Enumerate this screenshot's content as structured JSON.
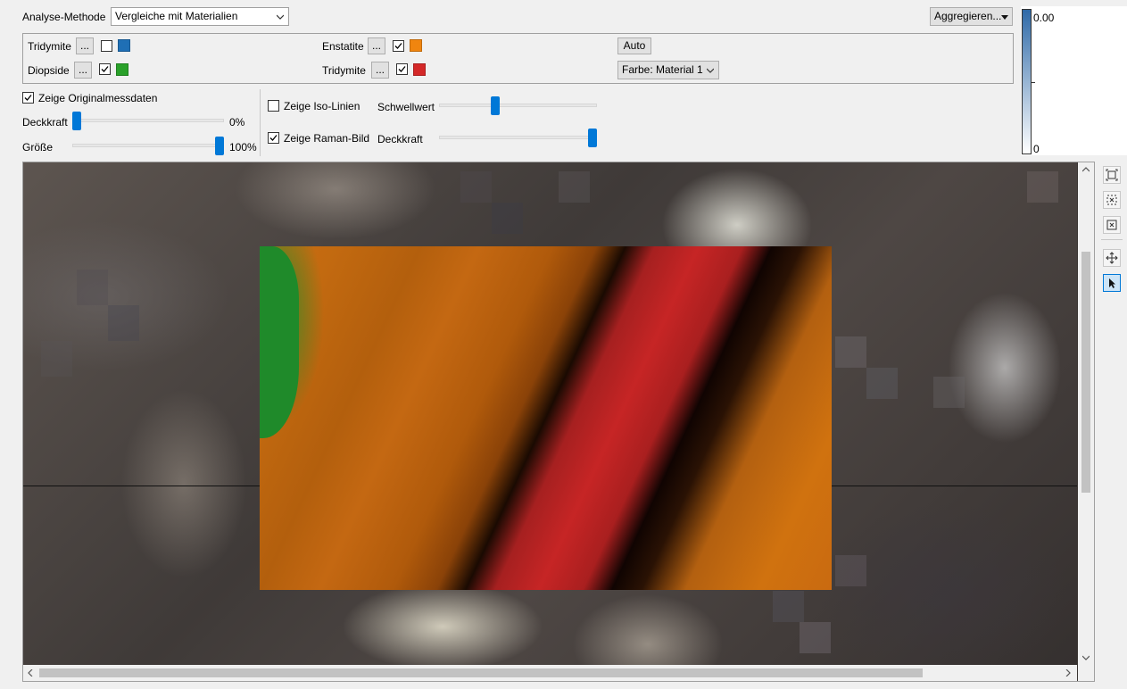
{
  "header": {
    "method_label": "Analyse-Methode",
    "method_value": "Vergleiche mit Materialien",
    "aggregate_button": "Aggregieren..."
  },
  "materials": {
    "ellipsis": "...",
    "items": [
      {
        "name": "Tridymite",
        "checked": false,
        "color": "#1f6fb5"
      },
      {
        "name": "Diopside",
        "checked": true,
        "color": "#2aa12a"
      },
      {
        "name": "Enstatite",
        "checked": true,
        "color": "#f0850f"
      },
      {
        "name": "Tridymite",
        "checked": true,
        "color": "#d42828"
      }
    ],
    "auto_button": "Auto",
    "color_mode": "Farbe: Material 1"
  },
  "original": {
    "show_label": "Zeige Originalmessdaten",
    "opacity_label": "Deckkraft",
    "opacity_value": "0%",
    "opacity_level": 0,
    "size_label": "Größe",
    "size_value": "100%",
    "size_level": 1
  },
  "iso": {
    "show_label": "Zeige Iso-Linien",
    "threshold_label": "Schwellwert",
    "threshold_level": 0.35
  },
  "raman": {
    "show_label": "Zeige Raman-Bild",
    "opacity_label": "Deckkraft",
    "opacity_level": 1
  },
  "colorbar": {
    "max_label": "0.00",
    "min_label": "0",
    "color": "#2f6aa8"
  },
  "tools": [
    "fit-view-icon",
    "zoom-region-icon",
    "zoom-reset-icon",
    "pan-icon",
    "select-pointer-icon"
  ]
}
